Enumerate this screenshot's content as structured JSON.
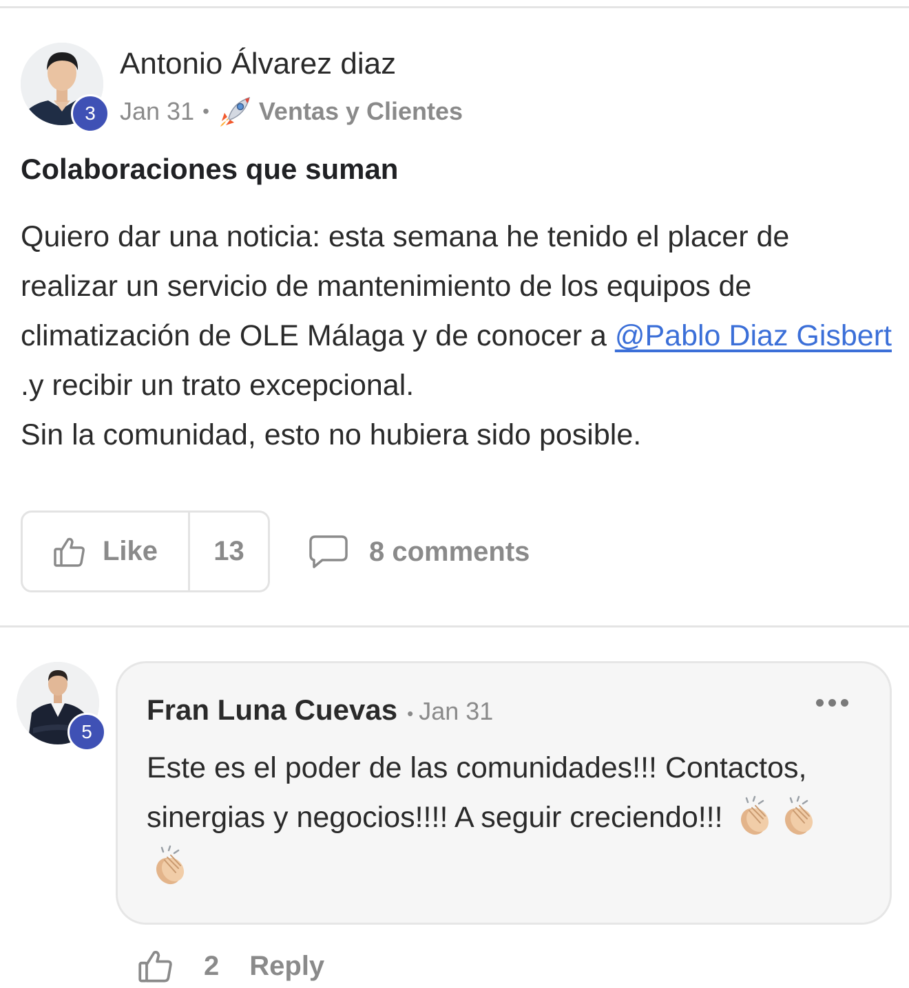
{
  "post": {
    "author": {
      "name": "Antonio Álvarez diaz",
      "level": "3"
    },
    "date": "Jan 31",
    "category": {
      "icon": "rocket-icon",
      "label": "Ventas y Clientes"
    },
    "title": "Colaboraciones que suman",
    "body": {
      "text_1": "Quiero dar una noticia: esta semana he tenido el placer de realizar un servicio de mantenimiento de los equipos de climatización de OLE Málaga y de conocer a ",
      "mention": "@Pablo Diaz Gisbert",
      "text_2": " .y recibir un trato excepcional.",
      "line_2": "Sin la comunidad, esto no hubiera sido posible."
    },
    "actions": {
      "like_label": "Like",
      "like_count": "13",
      "comments_label": "8 comments"
    }
  },
  "comment": {
    "author": {
      "name": "Fran Luna Cuevas",
      "level": "5"
    },
    "date": "Jan 31",
    "text": "Este es el poder de las comunidades!!! Contactos, sinergias y negocios!!!! A seguir creciendo!!!",
    "emojis": [
      "clapping-hands-icon",
      "clapping-hands-icon",
      "clapping-hands-icon"
    ],
    "like_count": "2",
    "reply_label": "Reply"
  },
  "colors": {
    "level_badge": "#3f51b5",
    "mention_link": "#3b6fd8",
    "muted_text": "#8a8a8a",
    "comment_bg": "#f6f6f6"
  }
}
